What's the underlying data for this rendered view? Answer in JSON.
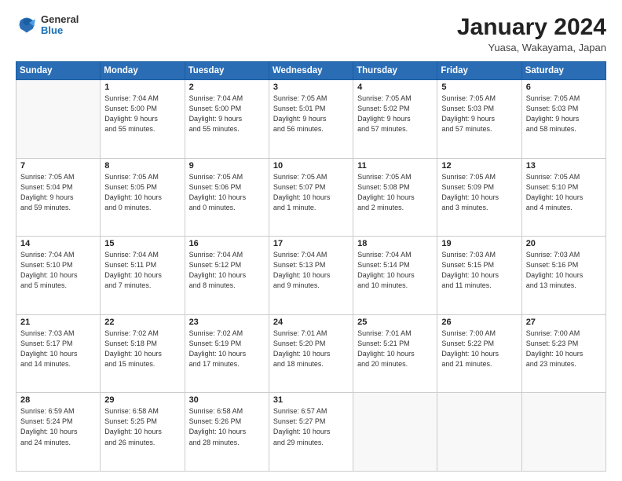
{
  "logo": {
    "general": "General",
    "blue": "Blue"
  },
  "header": {
    "title": "January 2024",
    "subtitle": "Yuasa, Wakayama, Japan"
  },
  "weekdays": [
    "Sunday",
    "Monday",
    "Tuesday",
    "Wednesday",
    "Thursday",
    "Friday",
    "Saturday"
  ],
  "weeks": [
    [
      {
        "day": "",
        "info": ""
      },
      {
        "day": "1",
        "info": "Sunrise: 7:04 AM\nSunset: 5:00 PM\nDaylight: 9 hours\nand 55 minutes."
      },
      {
        "day": "2",
        "info": "Sunrise: 7:04 AM\nSunset: 5:00 PM\nDaylight: 9 hours\nand 55 minutes."
      },
      {
        "day": "3",
        "info": "Sunrise: 7:05 AM\nSunset: 5:01 PM\nDaylight: 9 hours\nand 56 minutes."
      },
      {
        "day": "4",
        "info": "Sunrise: 7:05 AM\nSunset: 5:02 PM\nDaylight: 9 hours\nand 57 minutes."
      },
      {
        "day": "5",
        "info": "Sunrise: 7:05 AM\nSunset: 5:03 PM\nDaylight: 9 hours\nand 57 minutes."
      },
      {
        "day": "6",
        "info": "Sunrise: 7:05 AM\nSunset: 5:03 PM\nDaylight: 9 hours\nand 58 minutes."
      }
    ],
    [
      {
        "day": "7",
        "info": "Sunrise: 7:05 AM\nSunset: 5:04 PM\nDaylight: 9 hours\nand 59 minutes."
      },
      {
        "day": "8",
        "info": "Sunrise: 7:05 AM\nSunset: 5:05 PM\nDaylight: 10 hours\nand 0 minutes."
      },
      {
        "day": "9",
        "info": "Sunrise: 7:05 AM\nSunset: 5:06 PM\nDaylight: 10 hours\nand 0 minutes."
      },
      {
        "day": "10",
        "info": "Sunrise: 7:05 AM\nSunset: 5:07 PM\nDaylight: 10 hours\nand 1 minute."
      },
      {
        "day": "11",
        "info": "Sunrise: 7:05 AM\nSunset: 5:08 PM\nDaylight: 10 hours\nand 2 minutes."
      },
      {
        "day": "12",
        "info": "Sunrise: 7:05 AM\nSunset: 5:09 PM\nDaylight: 10 hours\nand 3 minutes."
      },
      {
        "day": "13",
        "info": "Sunrise: 7:05 AM\nSunset: 5:10 PM\nDaylight: 10 hours\nand 4 minutes."
      }
    ],
    [
      {
        "day": "14",
        "info": "Sunrise: 7:04 AM\nSunset: 5:10 PM\nDaylight: 10 hours\nand 5 minutes."
      },
      {
        "day": "15",
        "info": "Sunrise: 7:04 AM\nSunset: 5:11 PM\nDaylight: 10 hours\nand 7 minutes."
      },
      {
        "day": "16",
        "info": "Sunrise: 7:04 AM\nSunset: 5:12 PM\nDaylight: 10 hours\nand 8 minutes."
      },
      {
        "day": "17",
        "info": "Sunrise: 7:04 AM\nSunset: 5:13 PM\nDaylight: 10 hours\nand 9 minutes."
      },
      {
        "day": "18",
        "info": "Sunrise: 7:04 AM\nSunset: 5:14 PM\nDaylight: 10 hours\nand 10 minutes."
      },
      {
        "day": "19",
        "info": "Sunrise: 7:03 AM\nSunset: 5:15 PM\nDaylight: 10 hours\nand 11 minutes."
      },
      {
        "day": "20",
        "info": "Sunrise: 7:03 AM\nSunset: 5:16 PM\nDaylight: 10 hours\nand 13 minutes."
      }
    ],
    [
      {
        "day": "21",
        "info": "Sunrise: 7:03 AM\nSunset: 5:17 PM\nDaylight: 10 hours\nand 14 minutes."
      },
      {
        "day": "22",
        "info": "Sunrise: 7:02 AM\nSunset: 5:18 PM\nDaylight: 10 hours\nand 15 minutes."
      },
      {
        "day": "23",
        "info": "Sunrise: 7:02 AM\nSunset: 5:19 PM\nDaylight: 10 hours\nand 17 minutes."
      },
      {
        "day": "24",
        "info": "Sunrise: 7:01 AM\nSunset: 5:20 PM\nDaylight: 10 hours\nand 18 minutes."
      },
      {
        "day": "25",
        "info": "Sunrise: 7:01 AM\nSunset: 5:21 PM\nDaylight: 10 hours\nand 20 minutes."
      },
      {
        "day": "26",
        "info": "Sunrise: 7:00 AM\nSunset: 5:22 PM\nDaylight: 10 hours\nand 21 minutes."
      },
      {
        "day": "27",
        "info": "Sunrise: 7:00 AM\nSunset: 5:23 PM\nDaylight: 10 hours\nand 23 minutes."
      }
    ],
    [
      {
        "day": "28",
        "info": "Sunrise: 6:59 AM\nSunset: 5:24 PM\nDaylight: 10 hours\nand 24 minutes."
      },
      {
        "day": "29",
        "info": "Sunrise: 6:58 AM\nSunset: 5:25 PM\nDaylight: 10 hours\nand 26 minutes."
      },
      {
        "day": "30",
        "info": "Sunrise: 6:58 AM\nSunset: 5:26 PM\nDaylight: 10 hours\nand 28 minutes."
      },
      {
        "day": "31",
        "info": "Sunrise: 6:57 AM\nSunset: 5:27 PM\nDaylight: 10 hours\nand 29 minutes."
      },
      {
        "day": "",
        "info": ""
      },
      {
        "day": "",
        "info": ""
      },
      {
        "day": "",
        "info": ""
      }
    ]
  ]
}
